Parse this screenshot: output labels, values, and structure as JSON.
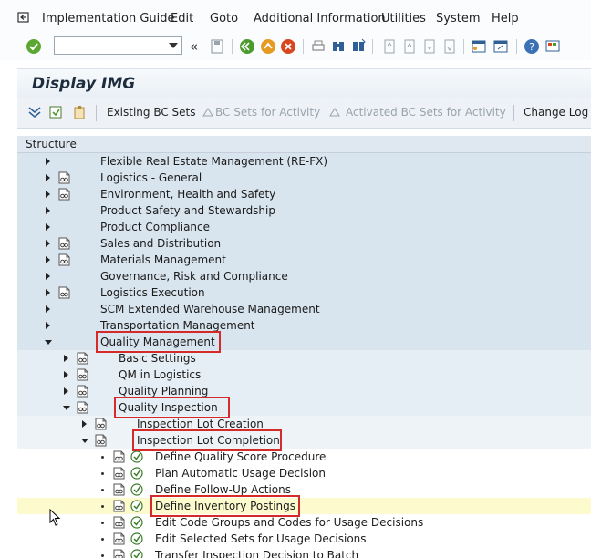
{
  "menubar": {
    "items": [
      {
        "label": "Implementation Guide"
      },
      {
        "label": "Edit"
      },
      {
        "label": "Goto"
      },
      {
        "label": "Additional Information"
      },
      {
        "label": "Utilities"
      },
      {
        "label": "System"
      },
      {
        "label": "Help"
      }
    ]
  },
  "toolbar": {
    "command_value": "",
    "nav_glyph": "«"
  },
  "title": "Display IMG",
  "app_toolbar": {
    "existing_bc_sets": "Existing BC Sets",
    "bc_sets_for_activity": "BC Sets for Activity",
    "activated_bc_sets": "Activated BC Sets for Activity",
    "change_log": "Change Log"
  },
  "tree": {
    "header": "Structure",
    "nodes": [
      {
        "label": "Flexible Real Estate Management (RE-FX)",
        "level": 0,
        "state": "collapsed",
        "doc": false
      },
      {
        "label": "Logistics - General",
        "level": 0,
        "state": "collapsed",
        "doc": true
      },
      {
        "label": "Environment, Health and Safety",
        "level": 0,
        "state": "collapsed",
        "doc": true
      },
      {
        "label": "Product Safety and Stewardship",
        "level": 0,
        "state": "collapsed",
        "doc": false
      },
      {
        "label": "Product Compliance",
        "level": 0,
        "state": "collapsed",
        "doc": false
      },
      {
        "label": "Sales and Distribution",
        "level": 0,
        "state": "collapsed",
        "doc": true
      },
      {
        "label": "Materials Management",
        "level": 0,
        "state": "collapsed",
        "doc": true
      },
      {
        "label": "Governance, Risk and Compliance",
        "level": 0,
        "state": "collapsed",
        "doc": false
      },
      {
        "label": "Logistics Execution",
        "level": 0,
        "state": "collapsed",
        "doc": true
      },
      {
        "label": "SCM Extended Warehouse Management",
        "level": 0,
        "state": "collapsed",
        "doc": false
      },
      {
        "label": "Transportation Management",
        "level": 0,
        "state": "collapsed",
        "doc": false
      },
      {
        "label": "Quality Management",
        "level": 0,
        "state": "expanded",
        "doc": false
      },
      {
        "label": "Basic Settings",
        "level": 1,
        "state": "collapsed",
        "doc": true
      },
      {
        "label": "QM in Logistics",
        "level": 1,
        "state": "collapsed",
        "doc": true
      },
      {
        "label": "Quality Planning",
        "level": 1,
        "state": "collapsed",
        "doc": true
      },
      {
        "label": "Quality Inspection",
        "level": 1,
        "state": "expanded",
        "doc": true
      },
      {
        "label": "Inspection Lot Creation",
        "level": 2,
        "state": "collapsed",
        "doc": true
      },
      {
        "label": "Inspection Lot Completion",
        "level": 2,
        "state": "expanded",
        "doc": true
      },
      {
        "label": "Define Quality Score Procedure",
        "level": 3,
        "state": "leaf",
        "doc": true
      },
      {
        "label": "Plan Automatic Usage Decision",
        "level": 3,
        "state": "leaf",
        "doc": true
      },
      {
        "label": "Define Follow-Up Actions",
        "level": 3,
        "state": "leaf",
        "doc": true
      },
      {
        "label": "Define Inventory Postings",
        "level": 3,
        "state": "leaf",
        "doc": true,
        "selected": true
      },
      {
        "label": "Edit Code Groups and Codes for Usage Decisions",
        "level": 3,
        "state": "leaf",
        "doc": true
      },
      {
        "label": "Edit Selected Sets for Usage Decisions",
        "level": 3,
        "state": "leaf",
        "doc": true
      },
      {
        "label": "Transfer Inspection Decision to Batch",
        "level": 3,
        "state": "leaf",
        "doc": true
      }
    ]
  },
  "colors": {
    "band0": "#d8e4ee",
    "band1": "#e6eef5",
    "band2": "#eef3f8",
    "band3": "#ffffff",
    "selected": "#fdfbcd",
    "highlight": "#d42a2a"
  }
}
